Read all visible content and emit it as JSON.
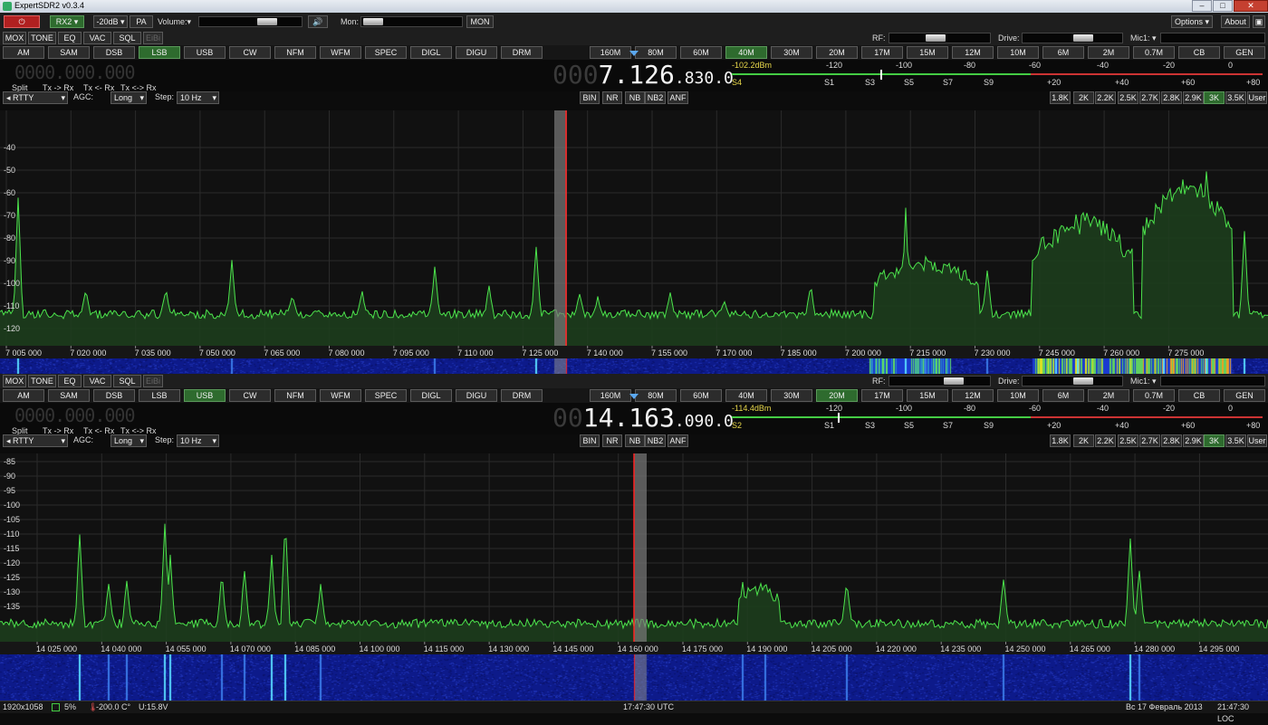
{
  "app": {
    "title": "ExpertSDR2 v0.3.4"
  },
  "toolbar": {
    "rx": "RX2",
    "att": "-20dB",
    "pa": "PA",
    "volume": "Volume:",
    "mon": "Mon:",
    "mon_btn": "MON",
    "options": "Options",
    "about": "About"
  },
  "rf_labels": {
    "rf": "RF:",
    "drive": "Drive:",
    "mic": "Mic1:"
  },
  "func_buttons": [
    "MOX",
    "TONE",
    "EQ",
    "VAC",
    "SQL",
    "EiBi"
  ],
  "modes": [
    "AM",
    "SAM",
    "DSB",
    "LSB",
    "USB",
    "CW",
    "NFM",
    "WFM",
    "SPEC",
    "DIGL",
    "DIGU",
    "DRM"
  ],
  "bands": [
    "160M",
    "80M",
    "60M",
    "40M",
    "30M",
    "20M",
    "17M",
    "15M",
    "12M",
    "10M",
    "6M",
    "2M",
    "0.7M",
    "CB",
    "GEN"
  ],
  "filters": [
    "1.8K",
    "2K",
    "2.2K",
    "2.5K",
    "2.7K",
    "2.8K",
    "2.9K",
    "3K",
    "3.5K",
    "User"
  ],
  "nr_buttons": [
    "BIN",
    "NR",
    "NB",
    "NB2",
    "ANF"
  ],
  "split_row": {
    "split": "Split",
    "txrx": "Tx -> Rx",
    "rxtx": "Tx <- Rx",
    "swap": "Tx <-> Rx"
  },
  "agc_row": {
    "mode": "RTTY",
    "agc": "AGC:",
    "agc_val": "Long",
    "step": "Step:",
    "step_val": "10 Hz"
  },
  "meter_scale": {
    "top": [
      "-120",
      "-100",
      "-80",
      "-60",
      "-40",
      "-20",
      "0"
    ],
    "bottom": [
      "S1",
      "S3",
      "S5",
      "S7",
      "S9",
      "+20",
      "+40",
      "+60",
      "+80"
    ]
  },
  "sub_freq": "0000.000.000",
  "rx1": {
    "freq_dim": "000",
    "freq_big": "7.126",
    "freq_small": ".830.0",
    "dbm": "-102.2dBm",
    "s": "S4",
    "mode_active": "LSB",
    "band_active": "40M",
    "filter_active": "3K",
    "meter_level": 0.28,
    "y_labels": [
      "-40",
      "-50",
      "-60",
      "-70",
      "-80",
      "-90",
      "-100",
      "-110",
      "-120"
    ],
    "x_labels": [
      "7 005 000",
      "7 020 000",
      "7 035 000",
      "7 050 000",
      "7 065 000",
      "7 080 000",
      "7 095 000",
      "7 110 000",
      "7 125 000",
      "7 140 000",
      "7 155 000",
      "7 170 000",
      "7 185 000",
      "7 200 000",
      "7 215 000",
      "7 230 000",
      "7 245 000",
      "7 260 000",
      "7 275 000"
    ]
  },
  "rx2": {
    "freq_dim": "00",
    "freq_big": "14.163",
    "freq_small": ".090.0",
    "dbm": "-114.4dBm",
    "s": "S2",
    "mode_active": "USB",
    "band_active": "20M",
    "filter_active": "3K",
    "meter_level": 0.2,
    "y_labels": [
      "-85",
      "-90",
      "-95",
      "-100",
      "-105",
      "-110",
      "-115",
      "-120",
      "-125",
      "-130",
      "-135"
    ],
    "x_labels": [
      "14 025 000",
      "14 040 000",
      "14 055 000",
      "14 070 000",
      "14 085 000",
      "14 100 000",
      "14 115 000",
      "14 130 000",
      "14 145 000",
      "14 160 000",
      "14 175 000",
      "14 190 000",
      "14 205 000",
      "14 220 000",
      "14 235 000",
      "14 250 000",
      "14 265 000",
      "14 280 000",
      "14 295 000"
    ]
  },
  "status": {
    "res": "1920x1058",
    "cpu": "5%",
    "temp": "-200.0 C°",
    "volt": "U:15.8V",
    "utc": "17:47:30 UTC",
    "date": "Вс 17 Февраль 2013",
    "loc": "21:47:30 LOC"
  },
  "colors": {
    "spectrum": "#4ce34c",
    "accent_on": "#2e6b2e",
    "cursor": "#ff2020",
    "meter_text": "#e8d84a"
  }
}
